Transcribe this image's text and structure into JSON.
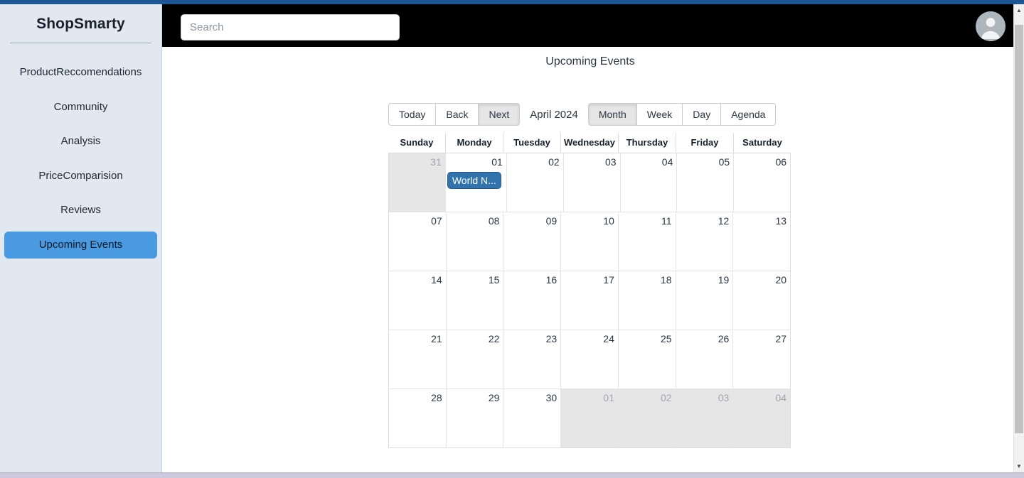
{
  "theme": {
    "chrome_blue": "#1c5494",
    "sidebar_bg": "#e2e8f0",
    "sidebar_active": "#4a9ae1",
    "topbar_bg": "#000000",
    "event_blue": "#3174ad",
    "off_range_bg": "#e6e6e6"
  },
  "sidebar": {
    "brand": "ShopSmarty",
    "items": [
      {
        "label": "ProductReccomendations",
        "active": false
      },
      {
        "label": "Community",
        "active": false
      },
      {
        "label": "Analysis",
        "active": false
      },
      {
        "label": "PriceComparision",
        "active": false
      },
      {
        "label": "Reviews",
        "active": false
      },
      {
        "label": "Upcoming Events",
        "active": true
      }
    ]
  },
  "header": {
    "search": {
      "value": "",
      "placeholder": "Search"
    },
    "avatar_icon": "user-avatar-icon"
  },
  "main": {
    "page_title": "Upcoming Events"
  },
  "calendar": {
    "toolbar": {
      "nav": [
        {
          "label": "Today",
          "active": false
        },
        {
          "label": "Back",
          "active": false
        },
        {
          "label": "Next",
          "active": true
        }
      ],
      "current_range_label": "April 2024",
      "views": [
        {
          "label": "Month",
          "active": true
        },
        {
          "label": "Week",
          "active": false
        },
        {
          "label": "Day",
          "active": false
        },
        {
          "label": "Agenda",
          "active": false
        }
      ]
    },
    "day_headers": [
      "Sunday",
      "Monday",
      "Tuesday",
      "Wednesday",
      "Thursday",
      "Friday",
      "Saturday"
    ],
    "weeks": [
      [
        {
          "day": "31",
          "off_range": true,
          "events": []
        },
        {
          "day": "01",
          "off_range": false,
          "events": [
            "World N..."
          ]
        },
        {
          "day": "02",
          "off_range": false,
          "events": []
        },
        {
          "day": "03",
          "off_range": false,
          "events": []
        },
        {
          "day": "04",
          "off_range": false,
          "events": []
        },
        {
          "day": "05",
          "off_range": false,
          "events": []
        },
        {
          "day": "06",
          "off_range": false,
          "events": []
        }
      ],
      [
        {
          "day": "07",
          "off_range": false,
          "events": []
        },
        {
          "day": "08",
          "off_range": false,
          "events": []
        },
        {
          "day": "09",
          "off_range": false,
          "events": []
        },
        {
          "day": "10",
          "off_range": false,
          "events": []
        },
        {
          "day": "11",
          "off_range": false,
          "events": []
        },
        {
          "day": "12",
          "off_range": false,
          "events": []
        },
        {
          "day": "13",
          "off_range": false,
          "events": []
        }
      ],
      [
        {
          "day": "14",
          "off_range": false,
          "events": []
        },
        {
          "day": "15",
          "off_range": false,
          "events": []
        },
        {
          "day": "16",
          "off_range": false,
          "events": []
        },
        {
          "day": "17",
          "off_range": false,
          "events": []
        },
        {
          "day": "18",
          "off_range": false,
          "events": []
        },
        {
          "day": "19",
          "off_range": false,
          "events": []
        },
        {
          "day": "20",
          "off_range": false,
          "events": []
        }
      ],
      [
        {
          "day": "21",
          "off_range": false,
          "events": []
        },
        {
          "day": "22",
          "off_range": false,
          "events": []
        },
        {
          "day": "23",
          "off_range": false,
          "events": []
        },
        {
          "day": "24",
          "off_range": false,
          "events": []
        },
        {
          "day": "25",
          "off_range": false,
          "events": []
        },
        {
          "day": "26",
          "off_range": false,
          "events": []
        },
        {
          "day": "27",
          "off_range": false,
          "events": []
        }
      ],
      [
        {
          "day": "28",
          "off_range": false,
          "events": []
        },
        {
          "day": "29",
          "off_range": false,
          "events": []
        },
        {
          "day": "30",
          "off_range": false,
          "events": []
        },
        {
          "day": "01",
          "off_range": true,
          "events": []
        },
        {
          "day": "02",
          "off_range": true,
          "events": []
        },
        {
          "day": "03",
          "off_range": true,
          "events": []
        },
        {
          "day": "04",
          "off_range": true,
          "events": []
        }
      ]
    ]
  },
  "scrollbar": {
    "up_arrow": "▲",
    "down_arrow": "▼"
  }
}
